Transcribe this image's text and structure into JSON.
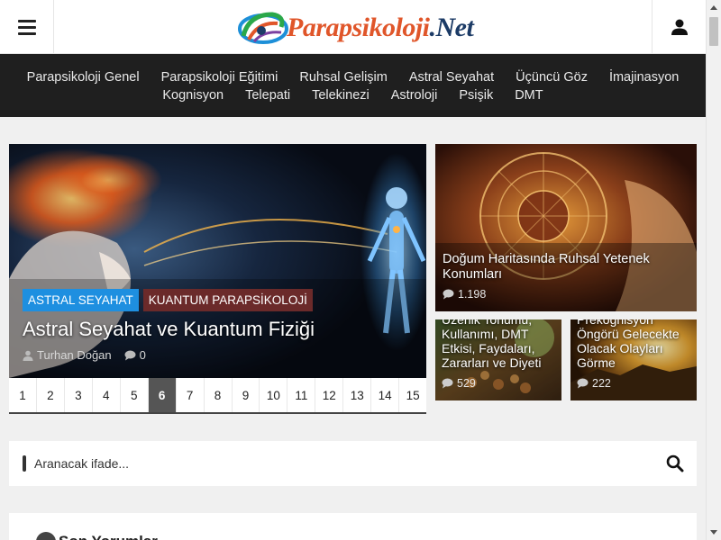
{
  "header": {
    "logo_part1": "Parapsikoloji",
    "logo_part2": ".Net",
    "menu_icon": "hamburger-menu-icon",
    "user_icon": "user-icon"
  },
  "nav": {
    "row1": [
      "Parapsikoloji Genel",
      "Parapsikoloji Eğitimi",
      "Ruhsal Gelişim",
      "Astral Seyahat",
      "Üçüncü Göz",
      "İmajinasyon"
    ],
    "row2": [
      "Kognisyon",
      "Telepati",
      "Telekinezi",
      "Astroloji",
      "Psişik",
      "DMT"
    ]
  },
  "featured": {
    "categories": [
      "ASTRAL SEYAHAT",
      "KUANTUM PARAPSİKOLOJİ"
    ],
    "title": "Astral Seyahat ve Kuantum Fiziği",
    "author": "Turhan Doğan",
    "comments": "0"
  },
  "pager": {
    "pages": [
      "1",
      "2",
      "3",
      "4",
      "5",
      "6",
      "7",
      "8",
      "9",
      "10",
      "11",
      "12",
      "13",
      "14",
      "15"
    ],
    "active": "6"
  },
  "cards": {
    "big": {
      "title": "Doğum Haritasında Ruhsal Yetenek Konumları",
      "views": "1.198"
    },
    "small1": {
      "title": "Üzerlik Tohumu, Kullanımı, DMT Etkisi, Faydaları, Zararları ve Diyeti",
      "views": "529"
    },
    "small2": {
      "title": "Prekognisyon Öngörü Gelecekte Olacak Olayları Görme",
      "views": "222"
    }
  },
  "search": {
    "placeholder": "Aranacak ifade...",
    "icon": "search-icon"
  },
  "comments_section": {
    "title": "Son Yorumlar"
  },
  "colors": {
    "nav_bg": "#1f1f1f",
    "cat_blue": "#1e8fe0",
    "cat_maroon": "#6b2a2a",
    "logo_orange": "#e0562a",
    "logo_navy": "#1c3b66",
    "pager_active": "#555555"
  }
}
